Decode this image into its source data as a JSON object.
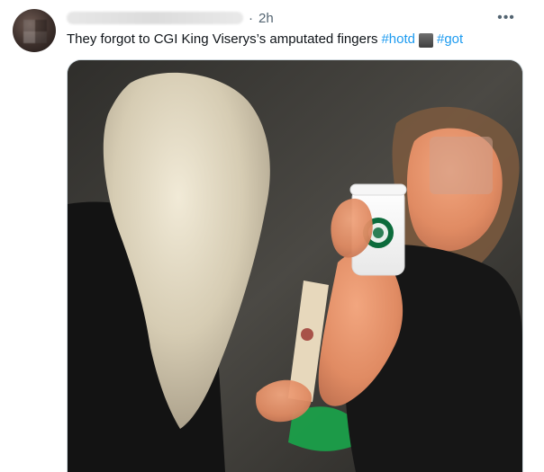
{
  "tweet": {
    "timestamp": "2h",
    "separator": "·",
    "more_label": "•••",
    "text_main": "They forgot to CGI King Viserys’s amputated fingers",
    "hashtags": [
      "#hotd",
      "#got"
    ],
    "emoji_icon": "king-emoji-icon",
    "accent_color": "#1d9bf0",
    "secondary_text_color": "#536471"
  },
  "media": {
    "cup_logo": "starbucks-logo-icon"
  }
}
